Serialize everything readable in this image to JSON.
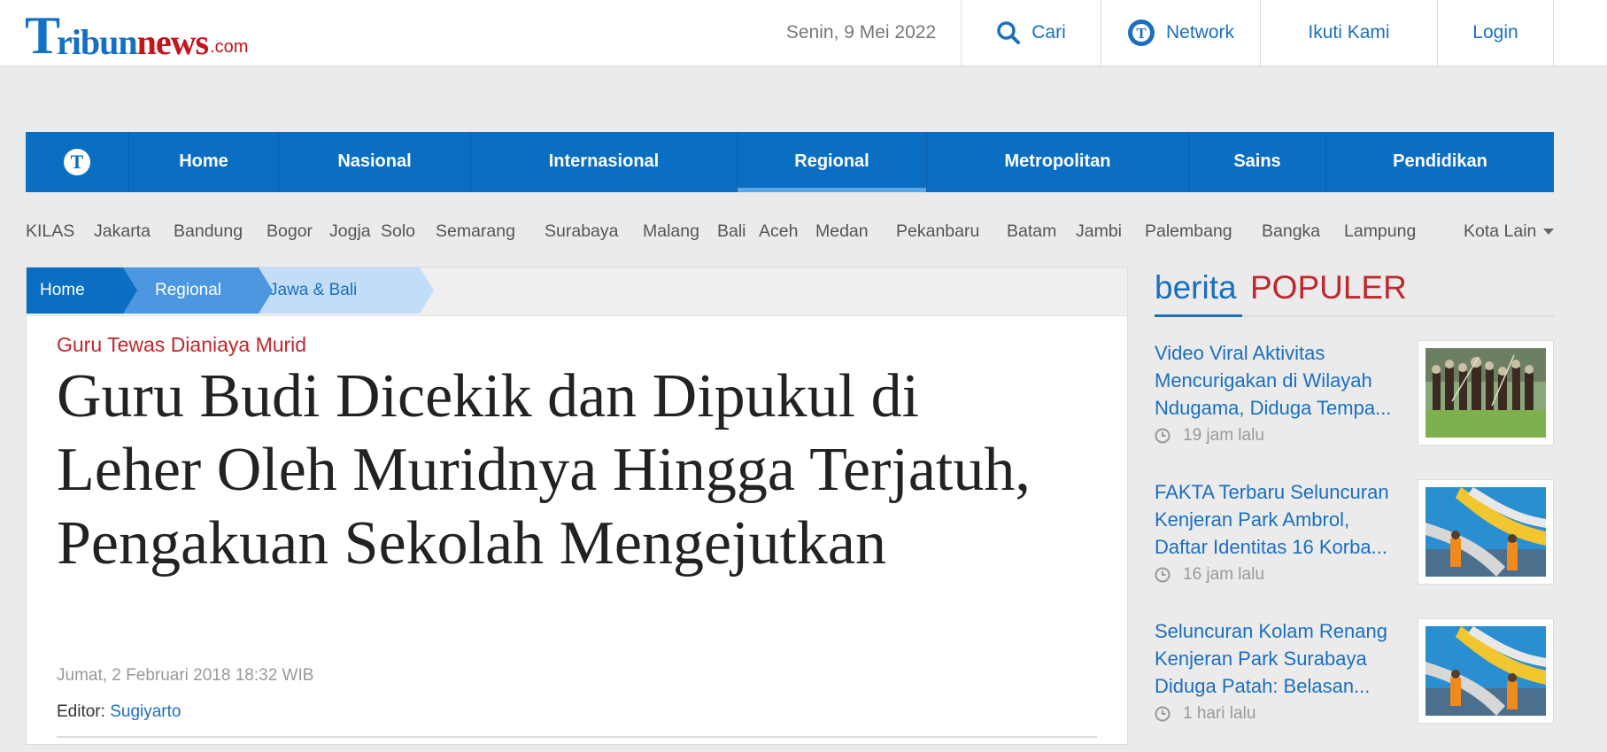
{
  "logo": {
    "t": "T",
    "ribun": "ribun",
    "news": "news",
    "com": ".com"
  },
  "topbar": {
    "date": "Senin, 9 Mei 2022",
    "search_label": "Cari",
    "network_label": "Network",
    "follow_label": "Ikuti Kami",
    "login_label": "Login"
  },
  "nav": {
    "logo_letter": "T",
    "items": [
      "Home",
      "Nasional",
      "Internasional",
      "Regional",
      "Metropolitan",
      "Sains",
      "Pendidikan"
    ],
    "active": "Regional"
  },
  "subnav": [
    "KILAS",
    "Jakarta",
    "Bandung",
    "Bogor",
    "Jogja",
    "Solo",
    "Semarang",
    "Surabaya",
    "Malang",
    "Bali",
    "Aceh",
    "Medan",
    "Pekanbaru",
    "Batam",
    "Jambi",
    "Palembang",
    "Bangka",
    "Lampung",
    "Kota Lain"
  ],
  "breadcrumb": [
    "Home",
    "Regional",
    "Jawa & Bali"
  ],
  "article": {
    "kicker": "Guru Tewas Dianiaya Murid",
    "headline": "Guru Budi Dicekik dan Dipukul di Leher Oleh Muridnya Hingga Terjatuh, Pengakuan Sekolah Mengejutkan",
    "date": "Jumat, 2 Februari 2018 18:32 WIB",
    "editor_label": "Editor:",
    "editor_name": "Sugiyarto"
  },
  "sidebar": {
    "heading_1": "berita",
    "heading_2": "POPULER",
    "items": [
      {
        "title": "Video Viral Aktivitas Mencurigakan di Wilayah Ndugama, Diduga Tempa...",
        "time": "19 jam lalu"
      },
      {
        "title": "FAKTA Terbaru Seluncuran Kenjeran Park Ambrol, Daftar Identitas 16 Korba...",
        "time": "16 jam lalu"
      },
      {
        "title": "Seluncuran Kolam Renang Kenjeran Park Surabaya Diduga Patah: Belasan...",
        "time": "1 hari lalu"
      }
    ]
  },
  "colors": {
    "brand_blue": "#0a6fc2",
    "link_blue": "#1b6fbf",
    "accent_red": "#c0262d"
  }
}
